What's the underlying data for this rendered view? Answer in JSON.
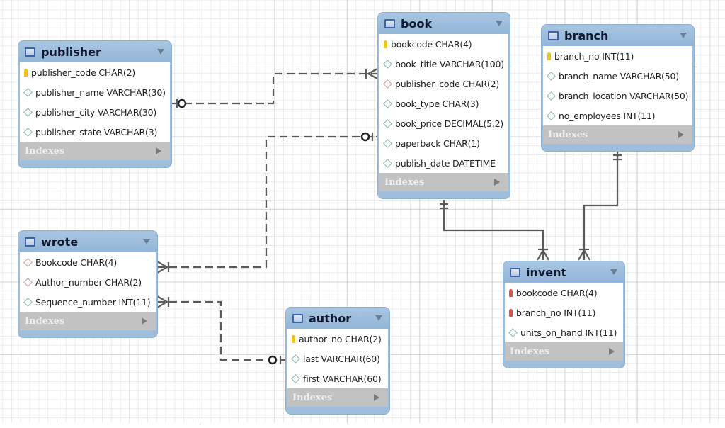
{
  "diagram": {
    "type": "EER diagram",
    "indexes_label": "Indexes"
  },
  "tables": {
    "publisher": {
      "name": "publisher",
      "columns": [
        {
          "key": "pk",
          "text": "publisher_code CHAR(2)"
        },
        {
          "key": "attr",
          "text": "publisher_name VARCHAR(30)"
        },
        {
          "key": "attr",
          "text": "publisher_city VARCHAR(30)"
        },
        {
          "key": "attr",
          "text": "publisher_state VARCHAR(3)"
        }
      ]
    },
    "book": {
      "name": "book",
      "columns": [
        {
          "key": "pk",
          "text": "bookcode CHAR(4)"
        },
        {
          "key": "attr",
          "text": "book_title VARCHAR(100)"
        },
        {
          "key": "fk",
          "text": "publisher_code CHAR(2)"
        },
        {
          "key": "attr",
          "text": "book_type CHAR(3)"
        },
        {
          "key": "attr",
          "text": "book_price DECIMAL(5,2)"
        },
        {
          "key": "attr",
          "text": "paperback CHAR(1)"
        },
        {
          "key": "attr",
          "text": "publish_date DATETIME"
        }
      ]
    },
    "branch": {
      "name": "branch",
      "columns": [
        {
          "key": "pk",
          "text": "branch_no INT(11)"
        },
        {
          "key": "attr",
          "text": "branch_name VARCHAR(50)"
        },
        {
          "key": "attr",
          "text": "branch_location VARCHAR(50)"
        },
        {
          "key": "attr",
          "text": "no_employees INT(11)"
        }
      ]
    },
    "wrote": {
      "name": "wrote",
      "columns": [
        {
          "key": "fk",
          "text": "Bookcode CHAR(4)"
        },
        {
          "key": "fk",
          "text": "Author_number CHAR(2)"
        },
        {
          "key": "attr",
          "text": "Sequence_number INT(11)"
        }
      ]
    },
    "author": {
      "name": "author",
      "columns": [
        {
          "key": "pk",
          "text": "author_no CHAR(2)"
        },
        {
          "key": "attr",
          "text": "last VARCHAR(60)"
        },
        {
          "key": "attr",
          "text": "first VARCHAR(60)"
        }
      ]
    },
    "invent": {
      "name": "invent",
      "columns": [
        {
          "key": "pkfk",
          "text": "bookcode CHAR(4)"
        },
        {
          "key": "pkfk",
          "text": "branch_no INT(11)"
        },
        {
          "key": "attr",
          "text": "units_on_hand INT(11)"
        }
      ]
    }
  },
  "relationships": [
    {
      "from": "publisher",
      "to": "book",
      "style": "dashed",
      "from_end": "zero-or-one",
      "to_end": "one-or-many"
    },
    {
      "from": "wrote",
      "to": "book",
      "style": "dashed",
      "from_end": "one-or-many",
      "to_end": "zero-or-one"
    },
    {
      "from": "wrote",
      "to": "author",
      "style": "dashed",
      "from_end": "one-or-many",
      "to_end": "zero-or-one"
    },
    {
      "from": "book",
      "to": "invent",
      "style": "solid",
      "from_end": "exactly-one",
      "to_end": "one-or-many"
    },
    {
      "from": "branch",
      "to": "invent",
      "style": "solid",
      "from_end": "exactly-one",
      "to_end": "one-or-many"
    }
  ],
  "colors": {
    "header": "#9fbedb",
    "indexes_bar": "#c2c2c2",
    "pk_key": "#f0c419",
    "pkfk_key": "#d9534f",
    "link": "#555555"
  }
}
